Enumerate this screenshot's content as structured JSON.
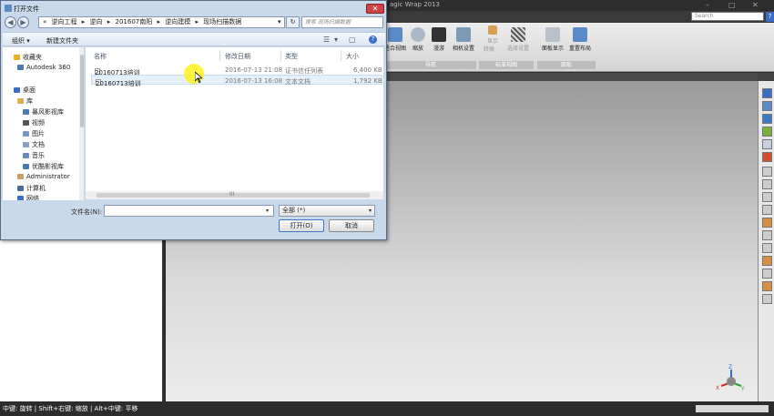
{
  "app": {
    "title": "agic Wrap 2013",
    "search_placeholder": "Search",
    "help": "?",
    "win_min": "–",
    "win_max": "□",
    "win_close": "✕"
  },
  "ribbon": {
    "buttons": [
      {
        "label": "适合视图",
        "icon": "fit-view-icon"
      },
      {
        "label": "缩放",
        "icon": "zoom-icon"
      },
      {
        "label": "漫游",
        "icon": "road-icon"
      },
      {
        "label": "相机设置",
        "icon": "camera-icon"
      },
      {
        "label": "显示",
        "icon": "display-icon"
      },
      {
        "label": "转换",
        "icon": "convert-icon"
      },
      {
        "label": "选择设置",
        "icon": "select-settings-icon"
      },
      {
        "label": "面板显示",
        "icon": "panel-display-icon"
      },
      {
        "label": "重置布局",
        "icon": "reset-layout-icon"
      }
    ],
    "groups": [
      "导航",
      "标准视图",
      "面板"
    ]
  },
  "status": {
    "text": "中键: 旋转 | Shift+右键: 缩放 | Alt+中键: 平移"
  },
  "triad": {
    "x": "X",
    "y": "Y",
    "z": "Z"
  },
  "dialog": {
    "title": "打开文件",
    "close": "✕",
    "back": "◀",
    "forward": "▶",
    "address": [
      "«",
      "逆向工程",
      "▸",
      "逆向",
      "▸",
      "201607南阳",
      "▸",
      "逆向建模",
      "▸",
      "现场扫描数据"
    ],
    "address_dropdown": "▾",
    "refresh": "↻",
    "search_placeholder": "搜索 现场扫描数据",
    "organize": "组织 ▾",
    "new_folder": "新建文件夹",
    "view_icons": [
      "☰",
      "▾",
      "▢",
      "?"
    ],
    "nav": [
      {
        "label": "收藏夹",
        "icon": "favorites-star-icon",
        "color": "#e8b020"
      },
      {
        "label": "Autodesk 360",
        "icon": "cloud-icon",
        "color": "#4a7ab0"
      },
      {
        "label": "桌面",
        "icon": "desktop-icon",
        "color": "#3a6cc8"
      },
      {
        "label": "库",
        "icon": "library-icon",
        "color": "#d8b050"
      },
      {
        "label": "暴风影视库",
        "icon": "video-library-icon",
        "color": "#4a7ab0"
      },
      {
        "label": "视频",
        "icon": "video-icon",
        "color": "#555"
      },
      {
        "label": "图片",
        "icon": "pictures-icon",
        "color": "#7a9ac0"
      },
      {
        "label": "文档",
        "icon": "documents-icon",
        "color": "#8aa0c0"
      },
      {
        "label": "音乐",
        "icon": "music-icon",
        "color": "#6a8ab8"
      },
      {
        "label": "优酷影视库",
        "icon": "youku-library-icon",
        "color": "#4a7ab0"
      },
      {
        "label": "Administrator",
        "icon": "user-icon",
        "color": "#c8a060"
      },
      {
        "label": "计算机",
        "icon": "computer-icon",
        "color": "#4a6a98"
      },
      {
        "label": "网络",
        "icon": "network-icon",
        "color": "#3a6cc8"
      }
    ],
    "columns": [
      "名称",
      "修改日期",
      "类型",
      "大小"
    ],
    "files": [
      {
        "name": "20160713培训",
        "date": "2016-07-13 21:08",
        "type": "证书信任列表",
        "size": "6,400 KB"
      },
      {
        "name": "20160713培训",
        "date": "2016-07-13 16:08",
        "type": "文本文档",
        "size": "1,792 KB"
      }
    ],
    "scroll_grip": "III",
    "filename_label": "文件名(N):",
    "filename_value": "",
    "filter": "全部 (*)",
    "open": "打开(O)",
    "cancel": "取消"
  },
  "colors": {
    "accent": "#3a78c8",
    "viewport_top": "#9a9a9a",
    "dialog_frame": "#c9d9ec"
  }
}
